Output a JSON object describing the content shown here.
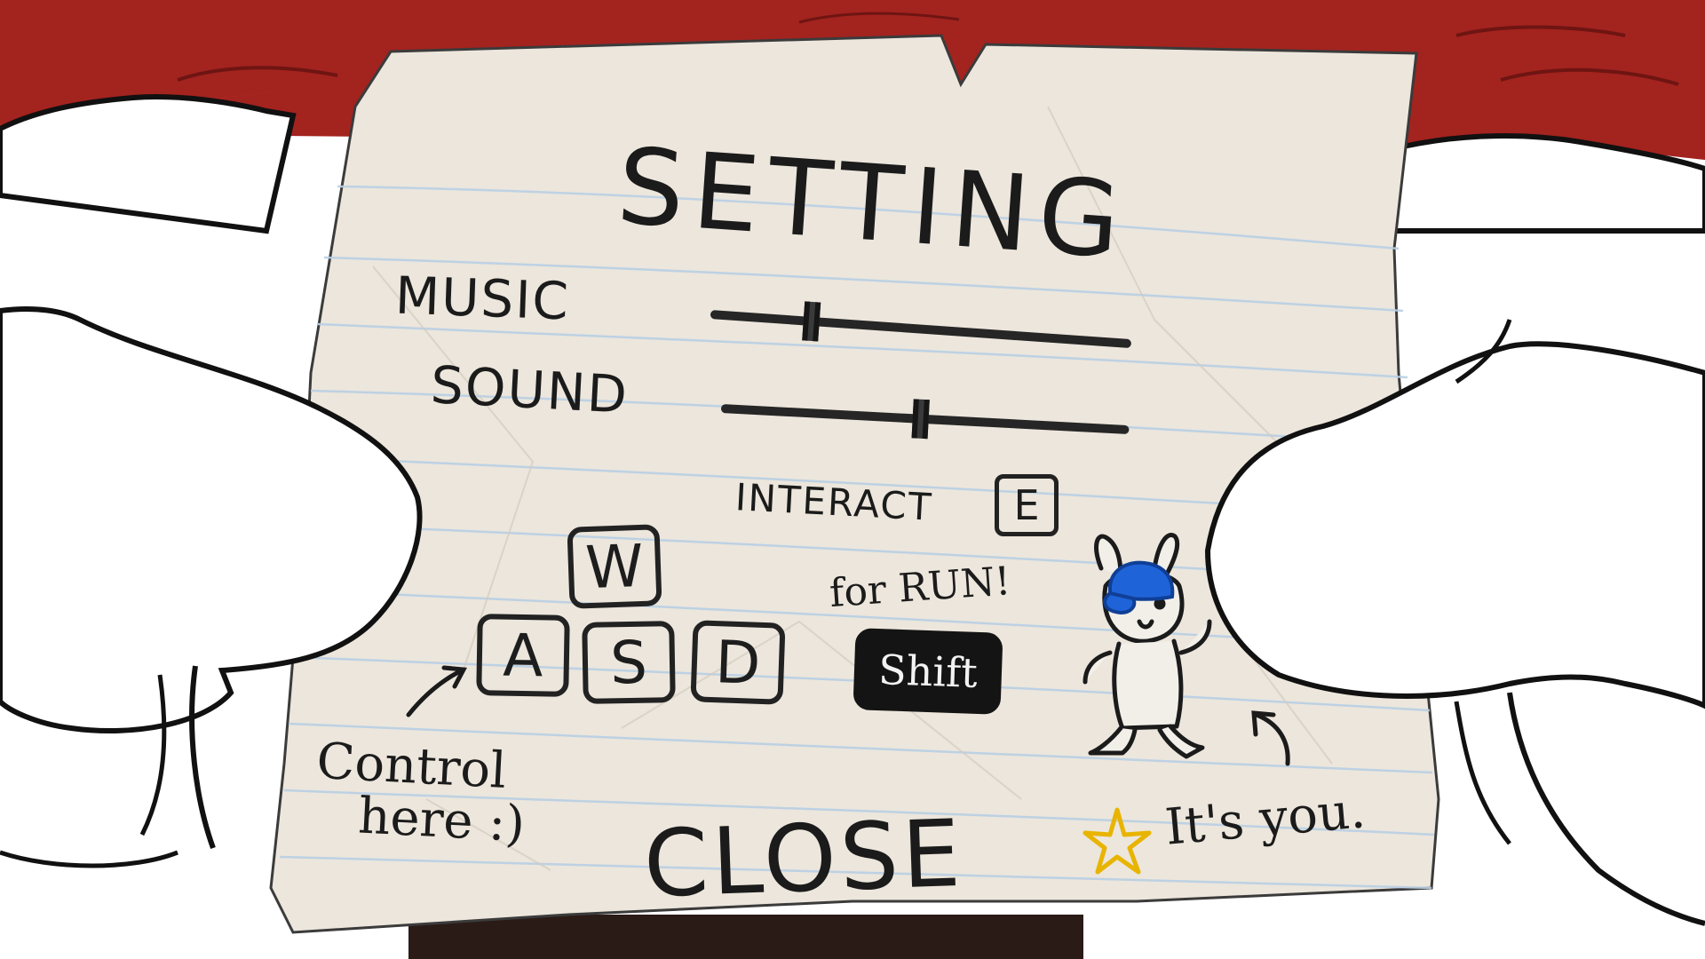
{
  "settings": {
    "title": "SETTING",
    "music": {
      "label": "MUSIC",
      "level": 0.24
    },
    "sound": {
      "label": "SOUND",
      "level": 0.49
    },
    "interact": {
      "label": "INTERACT",
      "key": "E"
    },
    "run": {
      "label": "for RUN!",
      "key": "Shift"
    },
    "movement_keys": {
      "up": "W",
      "left": "A",
      "down": "S",
      "right": "D"
    },
    "control_note": {
      "line1": "Control",
      "line2": "here :)"
    },
    "player_note": "It's you.",
    "close_label": "CLOSE"
  },
  "colors": {
    "backdrop_red": "#a3231f",
    "paper": "#ece6dc",
    "ink": "#1b1b1b",
    "ruled_line": "#b9cfe4",
    "cap_blue": "#1f63d8",
    "star_yellow": "#e8b400"
  },
  "icons": [
    "arrow-to-keys-icon",
    "arrow-to-player-icon",
    "star-icon",
    "bunny-player-icon",
    "cap-icon"
  ]
}
